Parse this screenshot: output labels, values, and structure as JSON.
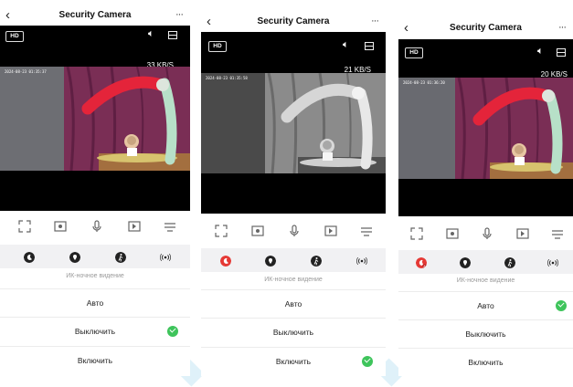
{
  "panels": [
    {
      "title": "Security Camera",
      "hd_label": "HD",
      "data_rate": "33 KB/S",
      "timestamp": "2024-08-23 01:35:37",
      "ir_label": "ИК-ночное видение",
      "options": [
        "Авто",
        "Выключить",
        "Включить"
      ],
      "selected_option": "Выключить",
      "night_mode_icon_state": "off"
    },
    {
      "title": "Security Camera",
      "hd_label": "HD",
      "data_rate": "21 KB/S",
      "timestamp": "2024-08-23 01:35:58",
      "ir_label": "ИК-ночное видение",
      "options": [
        "Авто",
        "Выключить",
        "Включить"
      ],
      "selected_option": "Включить",
      "night_mode_icon_state": "on"
    },
    {
      "title": "Security Camera",
      "hd_label": "HD",
      "data_rate": "20 KB/S",
      "timestamp": "2024-08-23 01:36:20",
      "ir_label": "ИК-ночное видение",
      "options": [
        "Авто",
        "Выключить",
        "Включить"
      ],
      "selected_option": "Авто",
      "night_mode_icon_state": "auto"
    }
  ],
  "icons": {
    "back": "chevron-left-icon",
    "more": "more-icon",
    "speaker": "speaker-icon",
    "layout": "layout-icon",
    "controls": [
      "fullscreen-icon",
      "screenshot-icon",
      "microphone-icon",
      "record-icon",
      "menu-icon"
    ],
    "modes": [
      "night-vision-icon",
      "location-icon",
      "motion-detection-icon",
      "wireless-icon"
    ]
  },
  "colors": {
    "check": "#3ec45b",
    "night_on": "#e53935",
    "night_off": "#222222",
    "mode_bar": "#f1f1f3"
  }
}
